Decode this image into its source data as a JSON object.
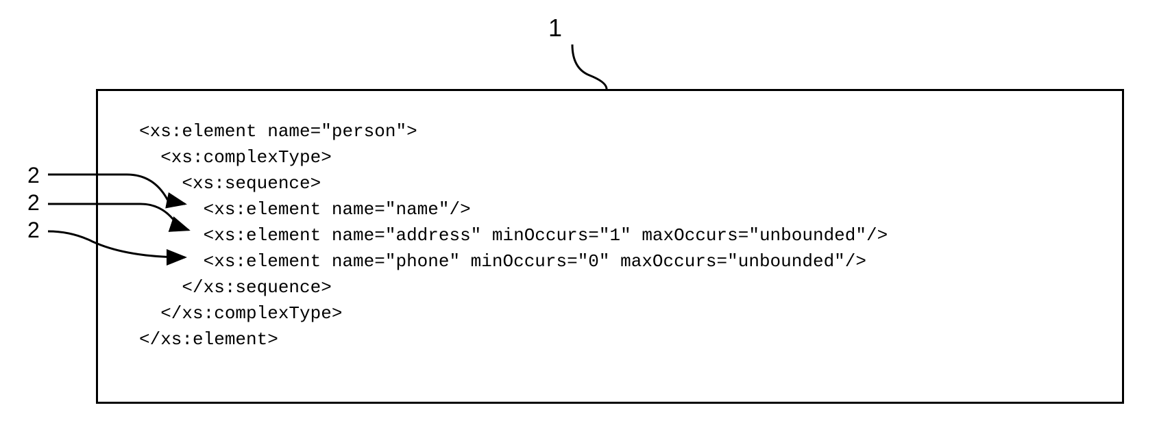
{
  "callouts": {
    "label1": "1",
    "label2a": "2",
    "label2b": "2",
    "label2c": "2"
  },
  "code": {
    "line1": "<xs:element name=\"person\">",
    "line2": "  <xs:complexType>",
    "line3": "    <xs:sequence>",
    "line4": "      <xs:element name=\"name\"/>",
    "line5": "      <xs:element name=\"address\" minOccurs=\"1\" maxOccurs=\"unbounded\"/>",
    "line6": "      <xs:element name=\"phone\" minOccurs=\"0\" maxOccurs=\"unbounded\"/>",
    "line7": "    </xs:sequence>",
    "line8": "  </xs:complexType>",
    "line9": "</xs:element>"
  }
}
